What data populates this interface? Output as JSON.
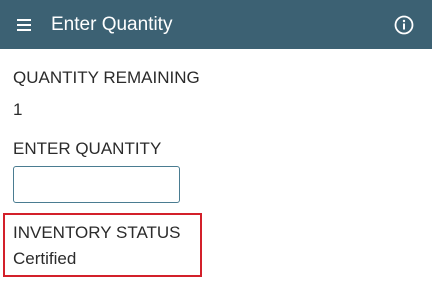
{
  "header": {
    "title": "Enter Quantity",
    "menu_icon": "hamburger-menu-icon",
    "info_icon": "info-circle-icon",
    "background_color": "#3c6173"
  },
  "quantity_remaining": {
    "label": "QUANTITY REMAINING",
    "value": "1"
  },
  "enter_quantity": {
    "label": "ENTER QUANTITY",
    "value": "",
    "placeholder": ""
  },
  "inventory_status": {
    "label": "INVENTORY STATUS",
    "value": "Certified",
    "highlight_color": "#d3202a"
  }
}
